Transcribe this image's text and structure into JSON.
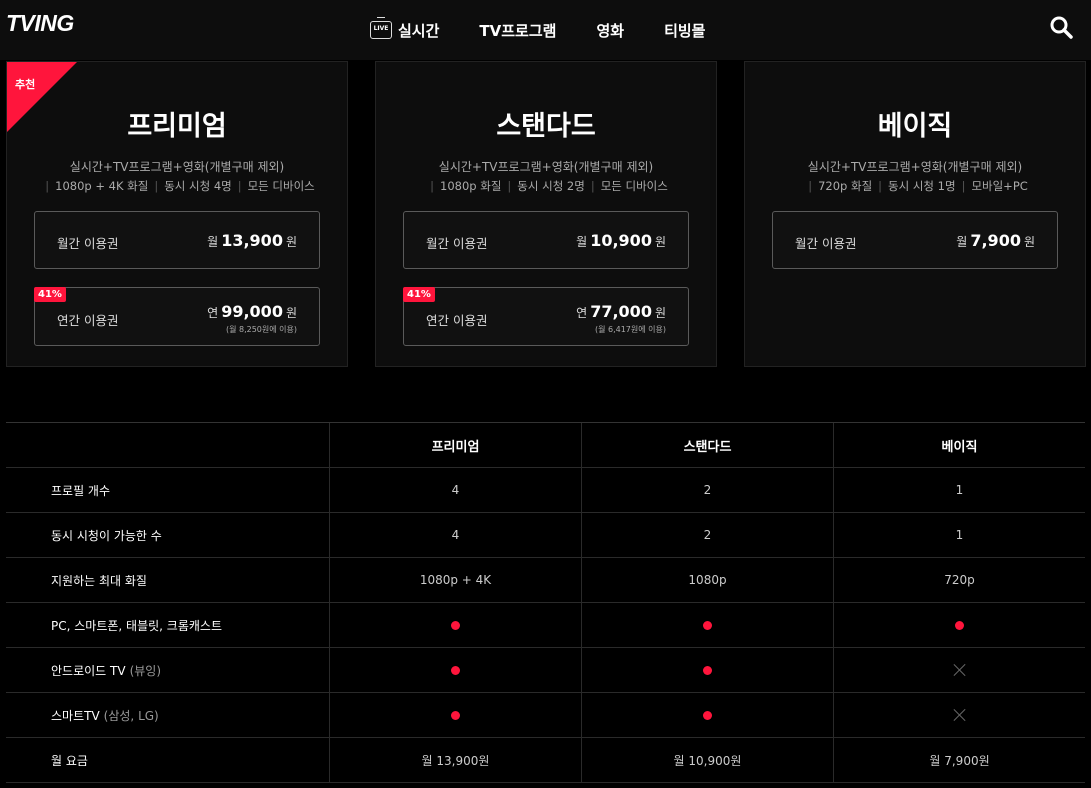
{
  "header": {
    "logo": "TVING",
    "nav": [
      {
        "label": "실시간",
        "icon": "live-tv-icon",
        "icon_text": "LIVE"
      },
      {
        "label": "TV프로그램"
      },
      {
        "label": "영화"
      },
      {
        "label": "티빙몰"
      }
    ],
    "search_icon": "search-icon"
  },
  "colors": {
    "accent": "#ff153c",
    "background": "#000000",
    "card": "#0d0d0d"
  },
  "plans": [
    {
      "ribbon": "추천",
      "name": "프리미엄",
      "desc": "실시간+TV프로그램+영화(개별구매 제외)",
      "features": [
        "1080p + 4K 화질",
        "동시 시청 4명",
        "모든 디바이스"
      ],
      "monthly": {
        "label": "월간 이용권",
        "prefix": "월",
        "amount": "13,900",
        "unit": "원"
      },
      "yearly": {
        "badge": "41%",
        "label": "연간 이용권",
        "prefix": "연",
        "amount": "99,000",
        "unit": "원",
        "sub": "(월 8,250원에 이용)"
      }
    },
    {
      "name": "스탠다드",
      "desc": "실시간+TV프로그램+영화(개별구매 제외)",
      "features": [
        "1080p 화질",
        "동시 시청 2명",
        "모든 디바이스"
      ],
      "monthly": {
        "label": "월간 이용권",
        "prefix": "월",
        "amount": "10,900",
        "unit": "원"
      },
      "yearly": {
        "badge": "41%",
        "label": "연간 이용권",
        "prefix": "연",
        "amount": "77,000",
        "unit": "원",
        "sub": "(월 6,417원에 이용)"
      }
    },
    {
      "name": "베이직",
      "desc": "실시간+TV프로그램+영화(개별구매 제외)",
      "features": [
        "720p 화질",
        "동시 시청 1명",
        "모바일+PC"
      ],
      "monthly": {
        "label": "월간 이용권",
        "prefix": "월",
        "amount": "7,900",
        "unit": "원"
      }
    }
  ],
  "table": {
    "headers": [
      "",
      "프리미엄",
      "스탠다드",
      "베이직"
    ],
    "rows": [
      {
        "label": "프로필 개수",
        "values": [
          "4",
          "2",
          "1"
        ]
      },
      {
        "label": "동시 시청이 가능한 수",
        "values": [
          "4",
          "2",
          "1"
        ]
      },
      {
        "label": "지원하는 최대 화질",
        "values": [
          "1080p + 4K",
          "1080p",
          "720p"
        ]
      },
      {
        "label": "PC, 스마트폰, 태블릿, 크롬캐스트",
        "values": [
          "dot",
          "dot",
          "dot"
        ]
      },
      {
        "label": "안드로이드 TV",
        "muted": "(뷰잉)",
        "values": [
          "dot",
          "dot",
          "x"
        ]
      },
      {
        "label": "스마트TV",
        "muted": "(삼성, LG)",
        "values": [
          "dot",
          "dot",
          "x"
        ]
      },
      {
        "label": "월 요금",
        "values": [
          "월 13,900원",
          "월 10,900원",
          "월 7,900원"
        ]
      }
    ]
  }
}
